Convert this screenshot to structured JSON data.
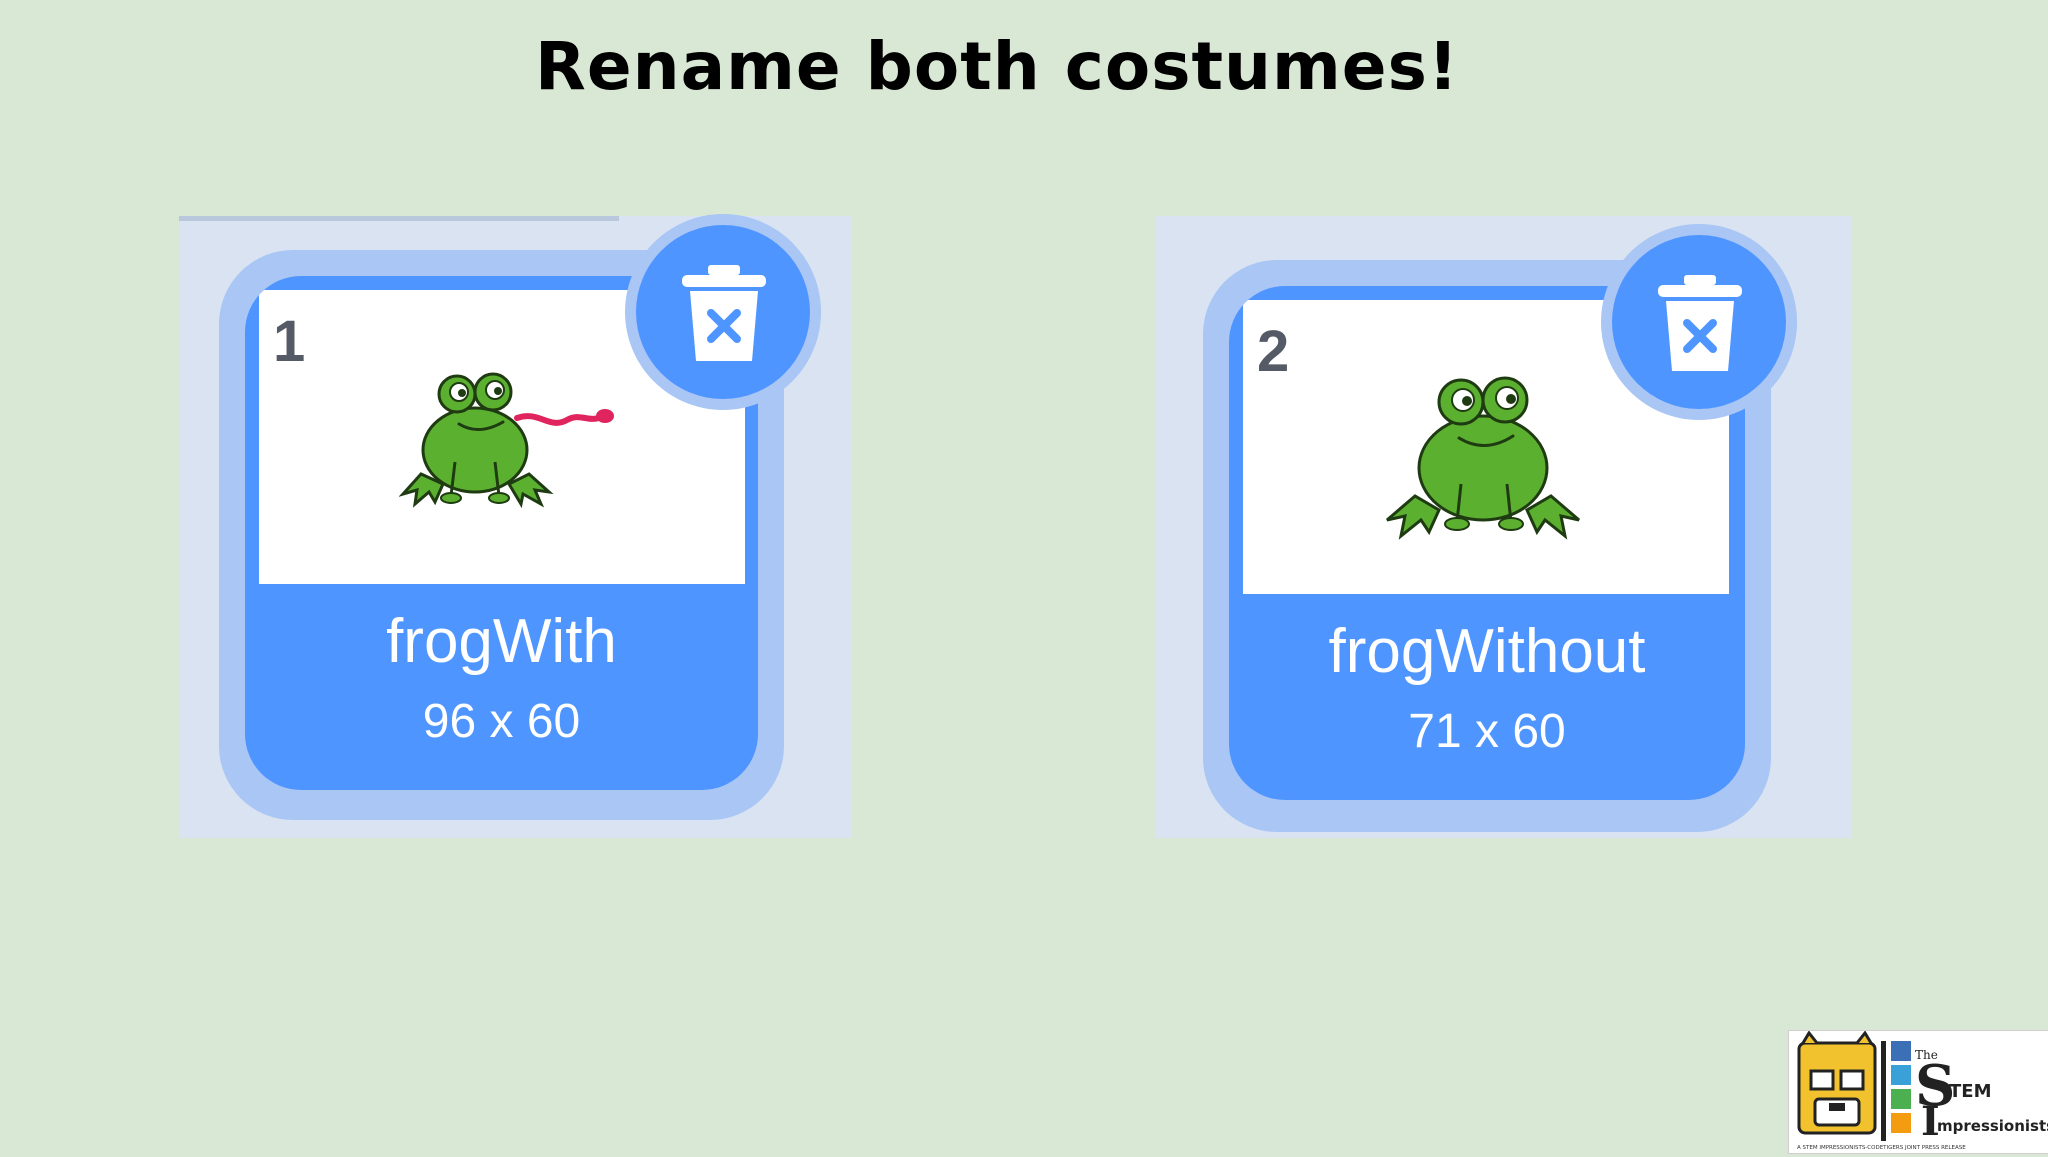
{
  "slide": {
    "title": "Rename both costumes!"
  },
  "costumes": [
    {
      "number": "1",
      "name": "frogWith",
      "size": "96 x 60",
      "image": "frog-with-tongue-icon"
    },
    {
      "number": "2",
      "name": "frogWithout",
      "size": "71 x 60",
      "image": "frog-icon"
    }
  ],
  "colors": {
    "background": "#d9e8d4",
    "card_blue": "#4f95ff",
    "card_halo": "#a9c6f5",
    "panel": "#d9e3f1",
    "tongue": "#e0245e",
    "frog_green": "#5cb030"
  },
  "logo": {
    "wordmark_the": "The",
    "wordmark_s": "S",
    "wordmark_tem": "TEM",
    "wordmark_i": "I",
    "wordmark_impressionists": "mpressionists",
    "tagline": "A STEM IMPRESSIONISTS-CODETIGERS JOINT PRESS RELEASE"
  }
}
